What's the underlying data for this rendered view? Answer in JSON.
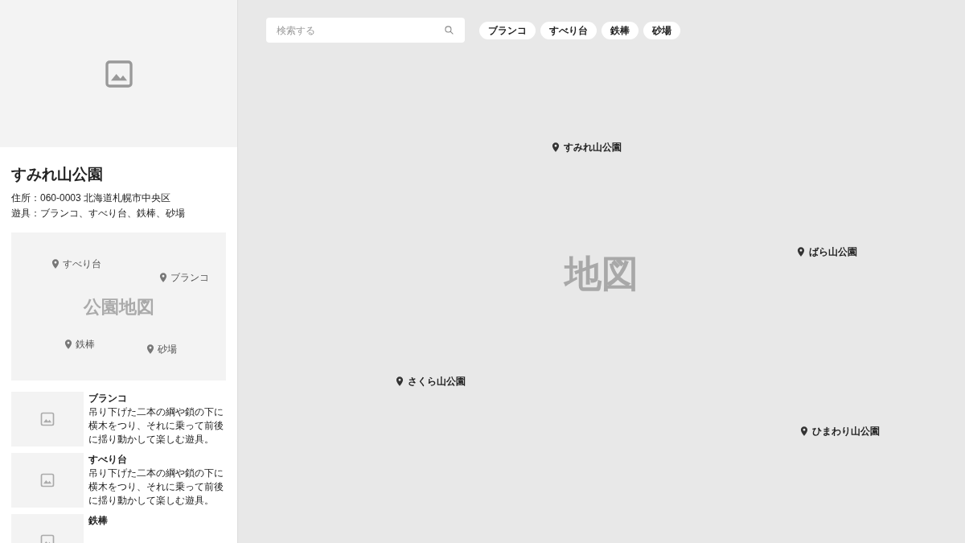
{
  "park": {
    "name": "すみれ山公園",
    "address": "住所：060-0003 北海道札幌市中央区",
    "equipment": "遊具：ブランコ、すべり台、鉄棒、砂場"
  },
  "park_map": {
    "label": "公園地図",
    "pins": [
      "すべり台",
      "ブランコ",
      "鉄棒",
      "砂場"
    ]
  },
  "equipment_list": [
    {
      "name": "ブランコ",
      "description": "吊り下げた二本の綱や鎖の下に横木をつり、それに乗って前後に揺り動かして楽しむ遊具。"
    },
    {
      "name": "すべり台",
      "description": "吊り下げた二本の綱や鎖の下に横木をつり、それに乗って前後に揺り動かして楽しむ遊具。"
    },
    {
      "name": "鉄棒"
    }
  ],
  "search": {
    "placeholder": "検索する"
  },
  "filters": [
    "ブランコ",
    "すべり台",
    "鉄棒",
    "砂場"
  ],
  "map": {
    "label": "地図",
    "pins": [
      "すみれ山公園",
      "ばら山公園",
      "さくら山公園",
      "ひまわり山公園"
    ]
  }
}
